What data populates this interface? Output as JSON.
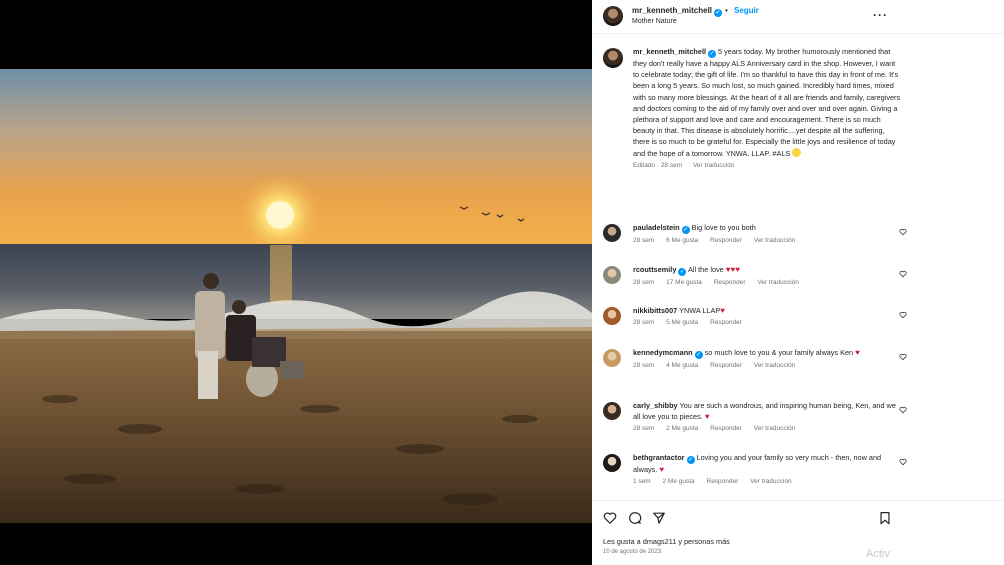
{
  "header": {
    "username": "mr_kenneth_mitchell",
    "follow_label": "Seguir",
    "subtitle": "Mother Nature",
    "more_icon": "more-dots-icon"
  },
  "caption": {
    "username": "mr_kenneth_mitchell",
    "text": "5 years today. My brother humorously mentioned that they don't really have a happy ALS Anniversary card in the shop. However, I want to celebrate today; the gift of life. I'm so thankful to have this day in front of me. It's been a long 5 years. So much lost, so much gained. Incredibly hard times, mixed with so many more blessings. At the heart of it all are friends and family, caregivers and doctors coming to the aid of my family over and over and over again. Giving a plethora of support and love and care and encouragement. There is so much beauty in that. This disease is absolutely horrific....yet despite all the suffering, there is so much to be grateful for. Especially the little joys and resilience of today and the hope of a tomorrow. YNWA. LLAP. #ALS",
    "edited_label": "Editado · 28 sem",
    "translate_label": "Ver traducción"
  },
  "comments": [
    {
      "username": "pauladelstein",
      "verified": true,
      "text": "Big love to you both",
      "age": "28 sem",
      "likes": "6 Me gusta",
      "reply": "Responder",
      "translate": "Ver traducción"
    },
    {
      "username": "rcouttsemily",
      "verified": true,
      "text": "All the love",
      "hearts": "♥♥♥",
      "age": "28 sem",
      "likes": "17 Me gusta",
      "reply": "Responder",
      "translate": "Ver traducción"
    },
    {
      "username": "nikkibitts007",
      "verified": false,
      "text": "YNWA LLAP",
      "hearts": "♥",
      "age": "28 sem",
      "likes": "5 Me gusta",
      "reply": "Responder"
    },
    {
      "username": "kennedymcmann",
      "verified": true,
      "text": "so much love to you & your family always Ken",
      "hearts": "♥",
      "age": "28 sem",
      "likes": "4 Me gusta",
      "reply": "Responder",
      "translate": "Ver traducción"
    },
    {
      "username": "carly_shibby",
      "verified": false,
      "text": "You are such a wondrous, and inspiring human being, Ken, and we all love you to pieces.",
      "hearts": "♥",
      "age": "28 sem",
      "likes": "2 Me gusta",
      "reply": "Responder",
      "translate": "Ver traducción"
    },
    {
      "username": "bethgrantactor",
      "verified": true,
      "text": "Loving you and your family so very much - then, now and always.",
      "hearts": "♥",
      "age": "1 sem",
      "likes": "2 Me gusta",
      "reply": "Responder",
      "translate": "Ver traducción"
    }
  ],
  "actions": {
    "like_icon": "heart-outline-icon",
    "comment_icon": "comment-icon",
    "share_icon": "send-icon",
    "save_icon": "bookmark-icon",
    "likes_text": "Les gusta a dmags211 y personas más",
    "date": "10 de agosto de 2023"
  },
  "watermark": "Activ",
  "colors": {
    "accent": "#0095f6",
    "heart": "#d21f3c",
    "sky_top": "#6f8fa8",
    "sun": "#ffe37a"
  }
}
